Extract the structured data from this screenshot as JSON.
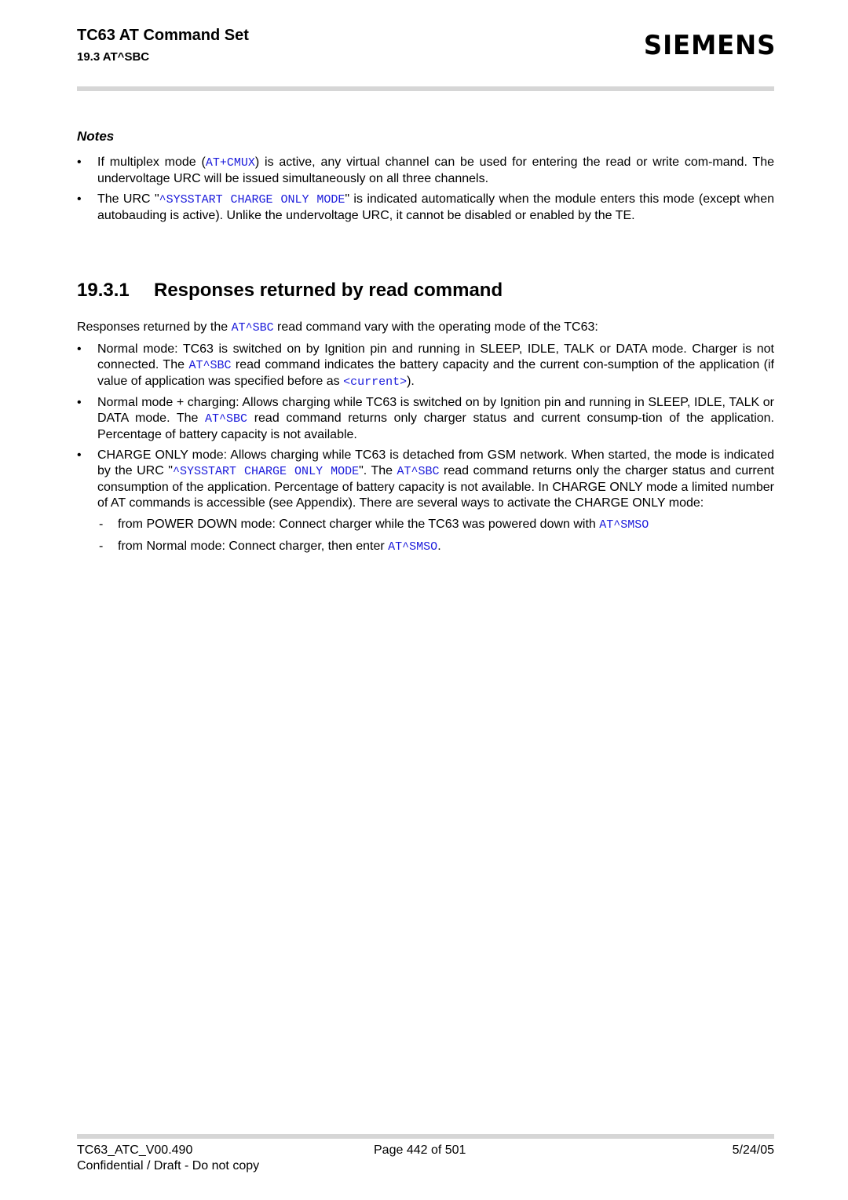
{
  "header": {
    "title": "TC63 AT Command Set",
    "section": "19.3 AT^SBC",
    "logo": "SIEMENS"
  },
  "notes": {
    "heading": "Notes",
    "items": [
      {
        "t1": "If multiplex mode (",
        "c1": "AT+CMUX",
        "t2": ") is active, any virtual channel can be used for entering the read or write com-mand. The undervoltage URC will be issued simultaneously on all three channels."
      },
      {
        "t1": "The URC \"",
        "c1": "^SYSSTART CHARGE ONLY MODE",
        "t2": "\" is indicated automatically when the module enters this mode (except when autobauding is active). Unlike the undervoltage URC, it cannot be disabled or enabled by the TE."
      }
    ]
  },
  "section": {
    "number": "19.3.1",
    "title": "Responses returned by read command",
    "intro": {
      "t1": "Responses returned by the ",
      "c1": "AT^SBC",
      "t2": " read command vary with the operating mode of the TC63:"
    },
    "items": [
      {
        "t1": "Normal mode: TC63 is switched on by Ignition pin and running in SLEEP, IDLE, TALK or DATA mode. Charger is not connected. The ",
        "c1": "AT^SBC",
        "t2": " read command indicates the battery capacity and the current con-sumption of the application (if value of application was specified before as ",
        "c2": "<current>",
        "t3": ")."
      },
      {
        "t1": "Normal mode + charging: Allows charging while TC63 is switched on by Ignition pin and running in SLEEP, IDLE, TALK or DATA mode. The ",
        "c1": "AT^SBC",
        "t2": " read command returns only charger status and current consump-tion of the application. Percentage of battery capacity is not available."
      },
      {
        "t1": "CHARGE ONLY mode: Allows charging while TC63 is detached from GSM network. When started, the mode is indicated by the URC \"",
        "c1": "^SYSSTART CHARGE ONLY MODE",
        "t2": "\". The ",
        "c2": "AT^SBC",
        "t3": " read command returns only the charger status and current consumption of the application. Percentage of battery capacity is not available. In CHARGE ONLY mode a limited number of AT commands is accessible (see Appendix). There are several ways to activate the CHARGE ONLY mode:",
        "sub": [
          {
            "t1": "from POWER DOWN mode: Connect charger while the TC63 was powered down with ",
            "c1": "AT^SMSO",
            "t2": ""
          },
          {
            "t1": "from Normal mode: Connect charger, then enter ",
            "c1": "AT^SMSO",
            "t2": "."
          }
        ]
      }
    ]
  },
  "footer": {
    "doc_id": "TC63_ATC_V00.490",
    "page": "Page 442 of 501",
    "date": "5/24/05",
    "confidential": "Confidential / Draft - Do not copy"
  },
  "colors": {
    "code": "#1a1adb",
    "bar": "#d6d6d6"
  }
}
